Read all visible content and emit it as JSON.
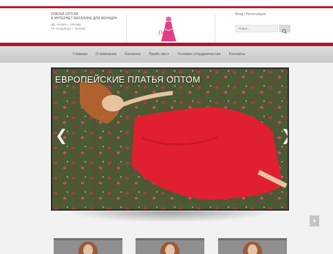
{
  "header": {
    "tagline_1": "ПЛАТЬЯ ОПТОМ",
    "tagline_2": "В ИНТЕРНЕТ МАГАЗИНЕ ДЛЯ ЖЕНЩИН",
    "address_1": "ДЦ «Нова» г. Москва,",
    "address_2": "ТК «Садовод» г. Москва",
    "logo_text": "Dress",
    "login_label": "Вход | Регистрация",
    "search_placeholder": "Поиск..."
  },
  "nav": {
    "items": [
      "Главная",
      "О компании",
      "Каталоги",
      "Прайс-лист",
      "Условия сотрудничества",
      "Контакты"
    ]
  },
  "slider": {
    "title": "ЕВРОПЕЙСКИЕ ПЛАТЬЯ ОПТОМ",
    "prev_arrow": "❮",
    "next_arrow": "❯"
  },
  "scroll_top": {
    "icon": "▲"
  },
  "colors": {
    "brand_red": "#c8172e",
    "nav_gray": "#d3d3d3",
    "dress_red": "#e02030"
  }
}
